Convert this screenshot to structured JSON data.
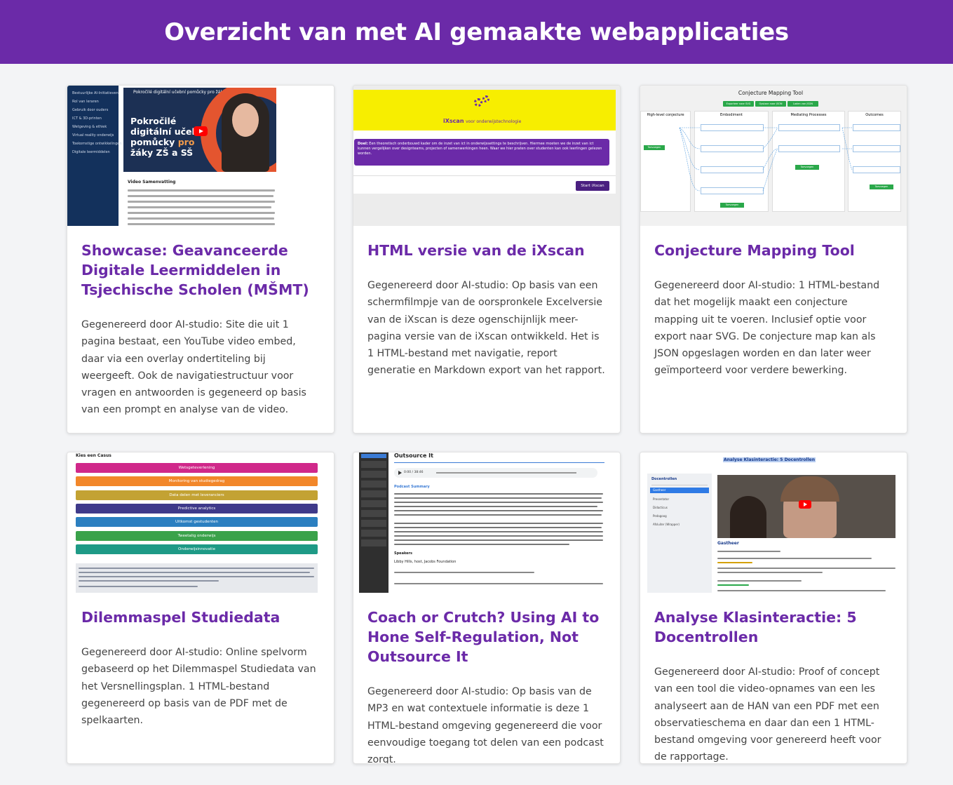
{
  "page": {
    "title": "Overzicht van met AI gemaakte webapplicaties"
  },
  "colors": {
    "header_bg": "#6b2aa8",
    "title": "#6b2aa8",
    "text": "#444444",
    "page_bg": "#f3f4f6"
  },
  "cards": [
    {
      "title": "Showcase: Geavanceerde Digitale Leermiddelen in Tsjechische Scholen (MŠMT)",
      "description": "Gegenereerd door AI-studio: Site die uit 1 pagina bestaat, een YouTube video embed, daar via een overlay ondertiteling bij weergeeft. Ook de navigatiestructuur voor vragen en antwoorden is gegeneerd op basis van een prompt en analyse van de video.",
      "thumb": {
        "video_title": "Pokročilé digitální učební pomůcky pro žáky ZŠ a SŠ",
        "poster_line1": "Pokročilé",
        "poster_line2": "digitální učební",
        "poster_line3": "pomůcky",
        "poster_pro": "pro",
        "poster_line4": "žáky ZŠ a SŠ",
        "section": "Video Samenvatting",
        "nav": [
          "Bestuurlijke AI-Initiatieven",
          "Rol van leraren",
          "Gebruik door ouders",
          "ICT & 3D-printen",
          "Wetgeving & ethiek",
          "Virtual reality onderwijs",
          "Toekomstige ontwikkelingen",
          "Digitale leermiddelen"
        ]
      }
    },
    {
      "title": "HTML versie van de iXscan",
      "description": "Gegenereerd door AI-studio: Op basis van een schermfilmpje van de oorspronkele Excelversie van de iXscan is deze ogenschijnlijk meer-pagina versie van de iXscan ontwikkeld. Het is 1 HTML-bestand met navigatie, report generatie en Markdown export van het rapport.",
      "thumb": {
        "brand": "iXscan",
        "tagline": "voor onderwijstechnologie",
        "doel_label": "Doel:",
        "doel_text": "Een theoretisch onderbouwd kader om de inzet van ict in onderwijssettings te beschrijven. Hiermee moeten we de inzet van ict kunnen vergelijken over designteams, projecten of samenwerkingen heen. Waar we hier praten over studenten kan ook leerlingen gelezen worden.",
        "start_button": "Start iXscan"
      }
    },
    {
      "title": "Conjecture Mapping Tool",
      "description": "Gegenereerd door AI-studio: 1 HTML-bestand dat het mogelijk maakt een conjecture mapping uit te voeren. Inclusief optie voor export naar SVG. De conjecture map kan als JSON opgeslagen worden en dan later weer geïmporteerd voor verdere bewerking.",
      "thumb": {
        "tool_title": "Conjecture Mapping Tool",
        "buttons": [
          "Exporteer naar SVG",
          "Opslaan naar JSON",
          "Laden van JSON"
        ],
        "columns": [
          "High-level conjecture",
          "Embodiment",
          "Mediating Processes",
          "Outcomes"
        ],
        "add_label": "Toevoegen"
      }
    },
    {
      "title": "Dilemmaspel Studiedata",
      "description": "Gegenereerd door AI-studio: Online spelvorm gebaseerd op het Dilemmaspel Studiedata van het Versnellingsplan. 1 HTML-bestand gegenereerd op basis van de PDF met de spelkaarten.",
      "thumb": {
        "heading": "Kies een Casus",
        "cases": [
          {
            "label": "Wetsgeteverlening",
            "color": "#d0288a"
          },
          {
            "label": "Monitoring van studiegedrag",
            "color": "#f2872a"
          },
          {
            "label": "Data delen met leveranciers",
            "color": "#c3a233"
          },
          {
            "label": "Predictive analytics",
            "color": "#3f3a8a"
          },
          {
            "label": "Uitkomst gestudenten",
            "color": "#2b7fc0"
          },
          {
            "label": "Tweetalig onderwijs",
            "color": "#3aa24a"
          },
          {
            "label": "Onderwijsinnovatie",
            "color": "#1e9a86"
          }
        ]
      }
    },
    {
      "title": "Coach or Crutch? Using AI to Hone Self-Regulation, Not Outsource It",
      "description": "Gegenereerd door AI-studio: Op basis van de MP3 en wat contextuele informatie is deze 1 HTML-bestand omgeving gegenereerd die voor eenvoudige toegang tot delen van een podcast zorgt.",
      "thumb": {
        "page_title": "Outsource It",
        "player_time": "0:00 / 38:46",
        "summary_heading": "Podcast Summary",
        "speakers_heading": "Speakers",
        "speaker": "Libby Hills, host, Jacobs Foundation"
      }
    },
    {
      "title": "Analyse Klasinteractie: 5 Docentrollen",
      "description": "Gegenereerd door AI-studio: Proof of concept van een tool die video-opnames van een les analyseert aan de HAN van een PDF met een observatieschema en daar dan een 1 HTML-bestand omgeving voor genereerd heeft voor de rapportage.",
      "thumb": {
        "header": "Analyse Klasinteractie: 5 Docentrollen",
        "sidebar_title": "Docentrollen",
        "roles": [
          "Gastheer",
          "Presentator",
          "Didacticus",
          "Pedagoog",
          "Afsluiter (Wrapper)"
        ],
        "active_role": "Gastheer",
        "role_heading": "Gastheer"
      }
    }
  ]
}
